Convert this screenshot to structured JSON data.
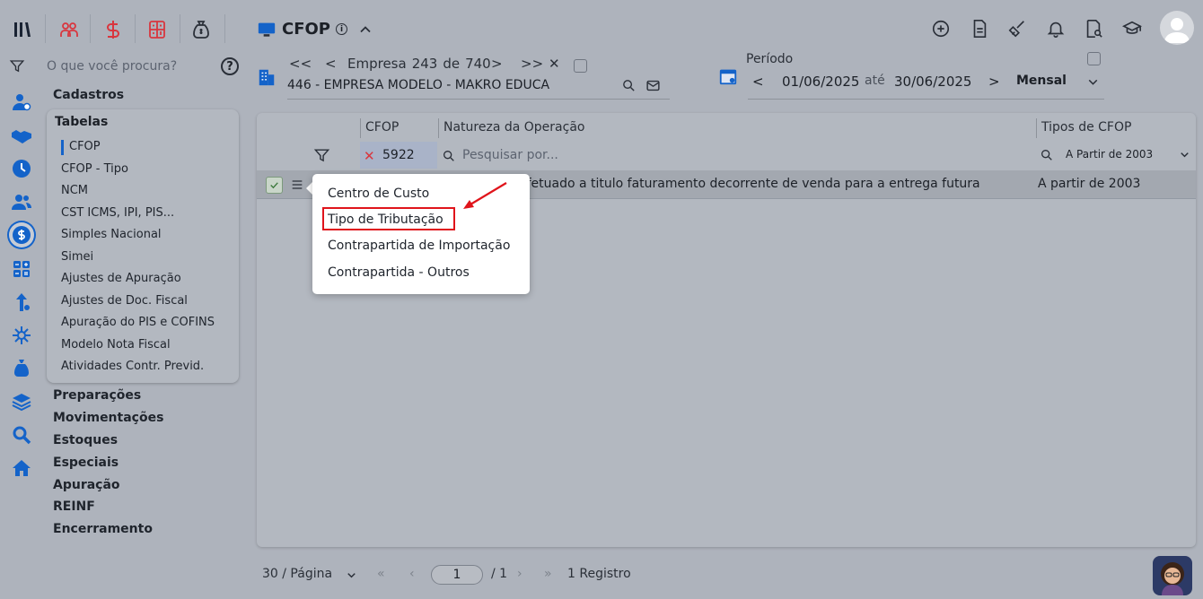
{
  "header": {
    "title": "CFOP",
    "title_info": "i"
  },
  "sidebar": {
    "search_placeholder": "O que você procura?",
    "help": "?",
    "sections": [
      "Cadastros",
      "Preparações",
      "Movimentações",
      "Estoques",
      "Especiais",
      "Apuração",
      "REINF",
      "Encerramento"
    ],
    "tabelas": {
      "title": "Tabelas",
      "items": [
        "CFOP",
        "CFOP - Tipo",
        "NCM",
        "CST ICMS, IPI, PIS...",
        "Simples Nacional",
        "Simei",
        "Ajustes de Apuração",
        "Ajustes de Doc. Fiscal",
        "Apuração do PIS e COFINS",
        "Modelo Nota Fiscal",
        "Atividades Contr. Previd."
      ]
    }
  },
  "empresa": {
    "prefix": "Empresa",
    "current": "243",
    "of_label": "de",
    "total": "740",
    "name": "446 - EMPRESA MODELO  - MAKRO EDUCA"
  },
  "periodo": {
    "label": "Período",
    "start": "01/06/2025",
    "until": "até",
    "end": "30/06/2025",
    "type": "Mensal"
  },
  "grid": {
    "columns": [
      "CFOP",
      "Natureza da Operação",
      "Tipos de CFOP"
    ],
    "filter_cfop": "5922",
    "filter_search_placeholder": "Pesquisar por...",
    "filter_tipos": "A Partir de 2003",
    "rows": [
      {
        "natureza_partial": "efetuado a titulo faturamento decorrente de venda para a entrega futura",
        "tipo": "A partir de 2003"
      }
    ]
  },
  "context_menu": {
    "items": [
      "Centro de Custo",
      "Tipo de Tributação",
      "Contrapartida de Importação",
      "Contrapartida - Outros"
    ]
  },
  "footer": {
    "per_page": "30 / Página",
    "page": "1",
    "total_pages": "/ 1",
    "records": "1 Registro"
  },
  "colors": {
    "accent": "#1463c9",
    "highlight": "#e0141b",
    "brand_red": "#d9363e"
  }
}
